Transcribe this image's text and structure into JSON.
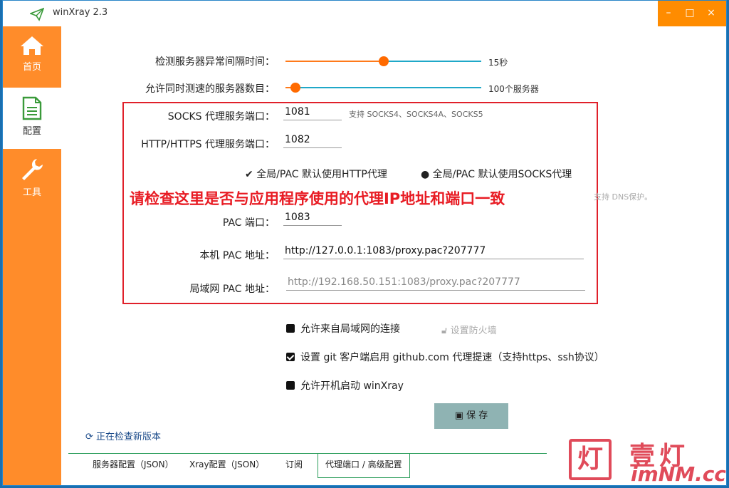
{
  "window": {
    "title": "winXray 2.3"
  },
  "titlebar": {
    "minimize": "–",
    "maximize": "□",
    "close": "×"
  },
  "sidebar": {
    "items": [
      {
        "label": "首页",
        "icon": "home-icon"
      },
      {
        "label": "配置",
        "icon": "document-icon"
      },
      {
        "label": "工具",
        "icon": "wrench-icon"
      }
    ]
  },
  "settings": {
    "check_interval": {
      "label": "检测服务器异常间隔时间：",
      "value": "15秒",
      "fraction": 0.5
    },
    "concurrent_tests": {
      "label": "允许同时测速的服务器数目：",
      "value": "100个服务器",
      "fraction": 0.05
    },
    "socks_port": {
      "label": "SOCKS 代理服务端口：",
      "value": "1081",
      "hint": "支持 SOCKS4、SOCKS4A、SOCKS5"
    },
    "http_port": {
      "label": "HTTP/HTTPS 代理服务端口：",
      "value": "1082"
    },
    "default_proxy": {
      "option_http": "全局/PAC 默认使用HTTP代理",
      "option_socks": "全局/PAC 默认使用SOCKS代理",
      "hidden_hint": "支持 DNS保护。"
    },
    "pac_port": {
      "label": "PAC 端口：",
      "value": "1083"
    },
    "local_pac": {
      "label": "本机 PAC 地址：",
      "value": "http://127.0.0.1:1083/proxy.pac?207777"
    },
    "lan_pac": {
      "label": "局域网 PAC 地址：",
      "value": "http://192.168.50.151:1083/proxy.pac?207777"
    },
    "allow_lan": {
      "label": "允许来自局域网的连接",
      "checked": true
    },
    "firewall": {
      "label": "设置防火墙"
    },
    "git_proxy": {
      "label": "设置 git 客户端启用 github.com 代理提速（支持https、ssh协议）",
      "checked": true
    },
    "autostart": {
      "label": "允许开机启动 winXray",
      "checked": true
    },
    "save_label": "保 存"
  },
  "annotation": {
    "text": "请检查这里是否与应用程序使用的代理IP地址和端口一致"
  },
  "update_status": "正在检查新版本",
  "tabs": [
    {
      "label": "服务器配置（JSON）",
      "active": false
    },
    {
      "label": "Xray配置（JSON）",
      "active": false
    },
    {
      "label": "订阅",
      "active": false
    },
    {
      "label": "代理端口 / 高级配置",
      "active": true
    }
  ],
  "watermark": {
    "big": "壹灯",
    "small": "imNM.cc",
    "box_char": "灯"
  },
  "colors": {
    "accent": "#ff8c2a",
    "annotation": "#e81c24",
    "slider": "#1fa8c8"
  }
}
